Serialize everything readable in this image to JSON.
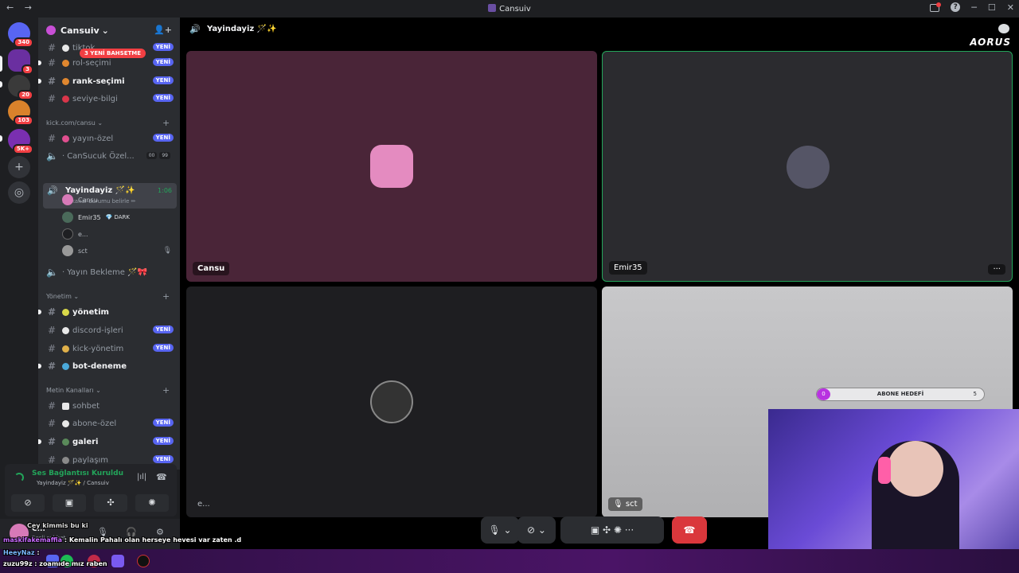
{
  "window": {
    "title": "Cansuiv",
    "nav_back": "←",
    "nav_forward": "→",
    "help": "?",
    "minimize": "─",
    "maximize": "☐",
    "close": "✕"
  },
  "rail": {
    "badges": [
      "340",
      "3",
      "20",
      "103",
      "5K+"
    ],
    "add": "+",
    "discover": "◎"
  },
  "guild": {
    "name": "Cansuiv",
    "chevron": "⌄",
    "mention_pill": "3 YENİ BAHSETME"
  },
  "channels_top": [
    {
      "name": "tiktok",
      "bold": false,
      "new": "YENİ"
    },
    {
      "name": "rol-seçimi",
      "bold": false,
      "new": "YENİ"
    },
    {
      "name": "rank-seçimi",
      "bold": true,
      "new": "YENİ"
    },
    {
      "name": "seviye-bilgi",
      "bold": false,
      "new": "YENİ"
    }
  ],
  "category_kick": "kick.com/cansu",
  "kick_channels": {
    "yayin_ozel": {
      "name": "yayın-özel",
      "new": "YENİ"
    },
    "cansucuk": {
      "name": "CanSucuk Özel...",
      "count_a": "00",
      "count_b": "99"
    }
  },
  "active_voice": {
    "name": "Yayindayiz 🪄✨",
    "time": "1:06",
    "status": "Bir kanal durumu belirle ✏"
  },
  "voice_users": [
    {
      "name": "Cansu",
      "tag": ""
    },
    {
      "name": "Emir35",
      "tag": "💎 DARK"
    },
    {
      "name": "e...",
      "tag": ""
    },
    {
      "name": "sct",
      "tag": ""
    }
  ],
  "yayin_bekleme": "Yayın Bekleme 🪄🎀",
  "category_yonetim": "Yönetim",
  "yonetim_channels": [
    {
      "name": "yönetim",
      "bold": true,
      "new": ""
    },
    {
      "name": "discord-işleri",
      "bold": false,
      "new": "YENİ"
    },
    {
      "name": "kick-yönetim",
      "bold": false,
      "new": "YENİ"
    },
    {
      "name": "bot-deneme",
      "bold": true,
      "new": ""
    }
  ],
  "category_metin": "Metin Kanalları",
  "metin_channels": [
    {
      "name": "sohbet",
      "bold": false,
      "new": ""
    },
    {
      "name": "abone-özel",
      "bold": false,
      "new": "YENİ"
    },
    {
      "name": "galeri",
      "bold": true,
      "new": "YENİ"
    },
    {
      "name": "paylaşım",
      "bold": false,
      "new": "YENİ"
    }
  ],
  "voice_panel": {
    "connected": "Ses Bağlantısı Kuruldu",
    "sub": "Yayindayiz 🪄✨ / Cansuiv"
  },
  "user": {
    "name": "C...",
    "status": "Sesli sohbet"
  },
  "call": {
    "channel_name": "Yayindayiz 🪄✨",
    "brand": "AORUS",
    "tiles": [
      {
        "label": "Cansu"
      },
      {
        "label": "Emir35",
        "more": "···"
      },
      {
        "label": "e..."
      },
      {
        "label": "sct"
      }
    ]
  },
  "overlay": {
    "goal_label": "ABONE HEDEFİ",
    "goal_current": "0",
    "goal_target": "5",
    "chat_line_1_user": "Cey kimmis bu ki",
    "chat_line_2_user": "maskifakemaffia",
    "chat_line_2_text": ": Kemalin Pahalı olan herseye hevesi var zaten .d",
    "chat_line_3_user": "HeeyNaz",
    "chat_line_3_text": ":",
    "chat_line_4_user": "zuzu99z",
    "chat_line_4_text": ": zoamıde mız raben"
  },
  "colors": {
    "accent_new": "#5865f2",
    "danger": "#da373c",
    "online": "#23a55a",
    "tile_cansu": "#4a2538",
    "tile_emir": "#2b2b2f",
    "tile_e": "#1e1e21",
    "tile_sct": "#c8c8ca"
  }
}
